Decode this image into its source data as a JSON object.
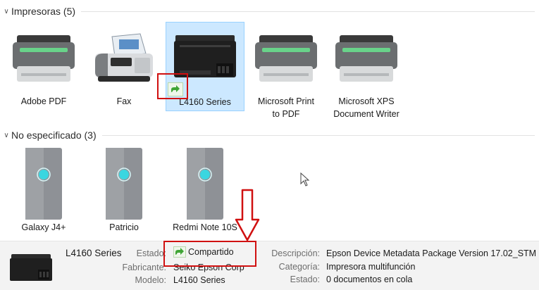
{
  "groups": {
    "printers_title": "Impresoras (5)",
    "unspecified_title": "No especificado (3)"
  },
  "printers": [
    {
      "label": "Adobe PDF",
      "icon": "printer-icon"
    },
    {
      "label": "Fax",
      "icon": "fax-icon"
    },
    {
      "label": "L4160 Series",
      "icon": "inkjet-printer-icon",
      "selected": true,
      "shared": true
    },
    {
      "label_line1": "Microsoft Print",
      "label_line2": "to PDF",
      "icon": "printer-icon"
    },
    {
      "label_line1": "Microsoft XPS",
      "label_line2": "Document Writer",
      "icon": "printer-icon"
    }
  ],
  "devices": [
    {
      "label": "Galaxy J4+",
      "icon": "generic-device-icon"
    },
    {
      "label": "Patricio",
      "icon": "generic-device-icon"
    },
    {
      "label": "Redmi Note 10S",
      "icon": "generic-device-icon"
    }
  ],
  "details": {
    "name": "L4160 Series",
    "estado_label": "Estado:",
    "estado_value": "Compartido",
    "fabricante_label": "Fabricante:",
    "fabricante_value": "Seiko Epson Corp",
    "modelo_label": "Modelo:",
    "modelo_value": "L4160 Series",
    "descripcion_label": "Descripción:",
    "descripcion_value": "Epson Device Metadata Package Version 17.02_STM",
    "categoria_label": "Categoría:",
    "categoria_value": "Impresora multifunción",
    "estado2_label": "Estado:",
    "estado2_value": "0 documentos en cola"
  },
  "colors": {
    "annotation_red": "#d01010",
    "selection_bg": "#cce8ff",
    "shared_green": "#3fa535"
  }
}
